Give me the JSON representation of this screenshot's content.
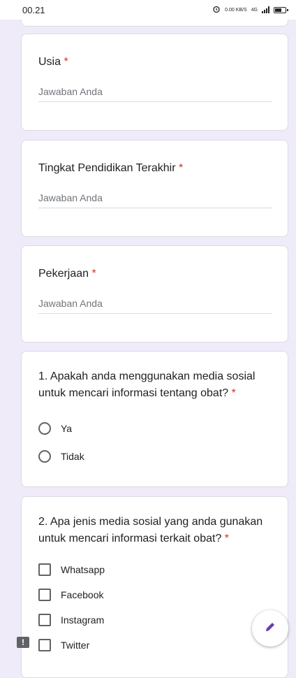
{
  "status_bar": {
    "time": "00.21",
    "net_speed": "0.00 KB/S",
    "net_type": "4G"
  },
  "questions": [
    {
      "title": "Usia",
      "required_mark": "*",
      "placeholder": "Jawaban Anda"
    },
    {
      "title": "Tingkat Pendidikan Terakhir",
      "required_mark": "*",
      "placeholder": "Jawaban Anda"
    },
    {
      "title": "Pekerjaan",
      "required_mark": "*",
      "placeholder": "Jawaban Anda"
    },
    {
      "title": "1. Apakah anda menggunakan media sosial untuk mencari informasi tentang obat?",
      "required_mark": "*",
      "options": [
        "Ya",
        "Tidak"
      ]
    },
    {
      "title": "2. Apa jenis media sosial yang anda gunakan untuk mencari informasi terkait obat?",
      "required_mark": "*",
      "options": [
        "Whatsapp",
        "Facebook",
        "Instagram",
        "Twitter"
      ]
    }
  ],
  "icons": {
    "fab": "edit-pencil-icon",
    "feedback": "report-feedback-icon"
  },
  "colors": {
    "background": "#f0ebf8",
    "required": "#d93025",
    "accent": "#673ab7"
  }
}
